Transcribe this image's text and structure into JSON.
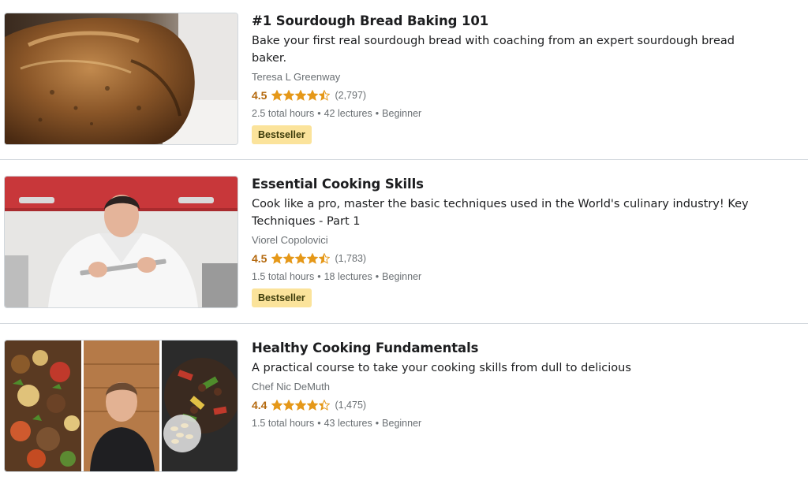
{
  "courses": [
    {
      "title": "#1 Sourdough Bread Baking 101",
      "headline": "Bake your first real sourdough bread with coaching from an expert sourdough bread baker.",
      "instructor": "Teresa L Greenway",
      "rating": "4.5",
      "rating_value": 4.5,
      "reviews": "(2,797)",
      "hours": "2.5 total hours",
      "lectures": "42 lectures",
      "level": "Beginner",
      "badge": "Bestseller"
    },
    {
      "title": "Essential Cooking Skills",
      "headline": "Cook like a pro, master the basic techniques used in the World's culinary industry! Key Techniques - Part 1",
      "instructor": "Viorel Copolovici",
      "rating": "4.5",
      "rating_value": 4.5,
      "reviews": "(1,783)",
      "hours": "1.5 total hours",
      "lectures": "18 lectures",
      "level": "Beginner",
      "badge": "Bestseller"
    },
    {
      "title": "Healthy Cooking Fundamentals",
      "headline": "A practical course to take your cooking skills from dull to delicious",
      "instructor": "Chef Nic DeMuth",
      "rating": "4.4",
      "rating_value": 4.4,
      "reviews": "(1,475)",
      "hours": "1.5 total hours",
      "lectures": "43 lectures",
      "level": "Beginner"
    }
  ],
  "meta_separator": "•",
  "colors": {
    "star": "#e59819",
    "rating": "#b4690e",
    "badge_bg": "#fbe39b"
  }
}
